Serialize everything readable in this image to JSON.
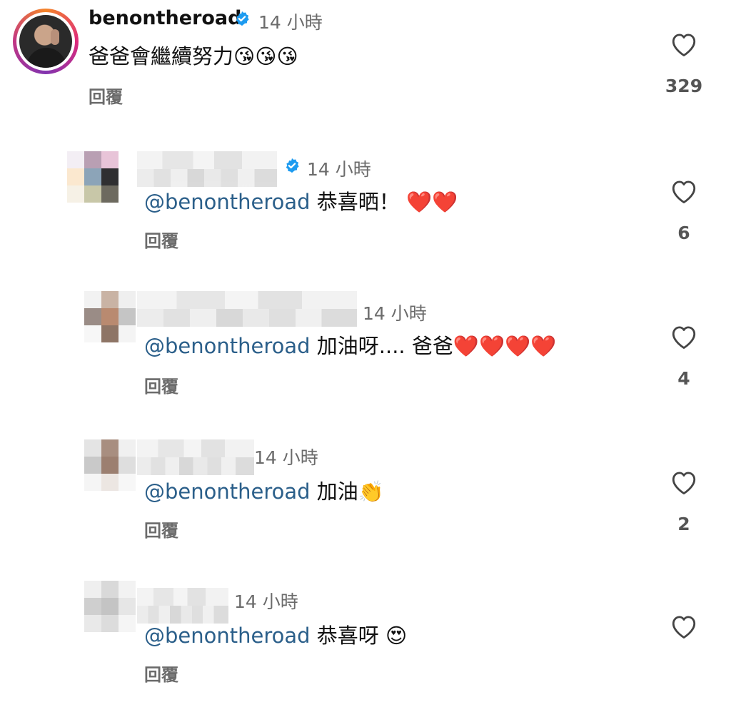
{
  "comments": [
    {
      "username": "benontheroad",
      "time": "14 小時",
      "text": "爸爸會繼續努力😘😘😘",
      "reply": "回覆",
      "likes": "329"
    },
    {
      "time": "14 小時",
      "mention": "@benontheroad",
      "text": " 恭喜晒！ ❤️❤️",
      "reply": "回覆",
      "likes": "6"
    },
    {
      "time": "14 小時",
      "mention": "@benontheroad",
      "text": " 加油呀.... 爸爸❤️❤️❤️❤️",
      "reply": "回覆",
      "likes": "4"
    },
    {
      "time": "14 小時",
      "mention": "@benontheroad",
      "text": " 加油👏",
      "reply": "回覆",
      "likes": "2"
    },
    {
      "time": "14 小時",
      "mention": "@benontheroad",
      "text": " 恭喜呀 😍",
      "reply": "回覆",
      "likes": ""
    }
  ],
  "icons": {
    "verified": "verified-badge-icon",
    "like": "heart-outline-icon"
  },
  "colors": {
    "mention": "#2b5f8a",
    "verified": "#1d9bf0",
    "muted": "#6b6b6b"
  }
}
